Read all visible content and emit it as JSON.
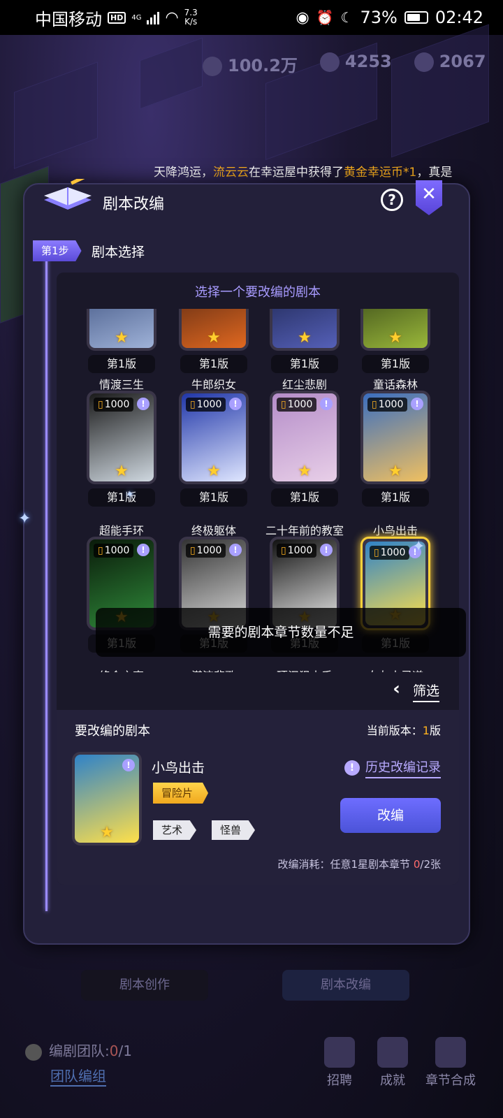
{
  "status_bar": {
    "carrier": "中国移动",
    "hd": "HD",
    "network": "4G",
    "speed_value": "7.3",
    "speed_unit": "K/s",
    "battery": "73%",
    "time": "02:42"
  },
  "currencies": [
    {
      "icon": "coin-icon",
      "value": "100.2万"
    },
    {
      "icon": "trophy-icon",
      "value": "4253"
    },
    {
      "icon": "energy-icon",
      "value": "2067"
    }
  ],
  "marquee": {
    "prefix": "天降鸿运，",
    "user": "流云云",
    "middle": "在幸运屋中获得了",
    "item": "黄金幸运币*1",
    "suffix": "，真是"
  },
  "modal": {
    "title": "剧本改编",
    "help_icon": "?",
    "close_icon": "✕",
    "step_tag": "第1步",
    "step_title": "剧本选择",
    "subtitle": "选择一个要改编的剧本",
    "version_label": "第1版",
    "cost_value": "1000",
    "toast": "需要的剧本章节数量不足",
    "filter_label": "筛选"
  },
  "scripts": [
    {
      "name": "",
      "colors": [
        "#2a3e6e",
        "#9fb2d8"
      ]
    },
    {
      "name": "",
      "colors": [
        "#3a1a10",
        "#e06820"
      ]
    },
    {
      "name": "",
      "colors": [
        "#101838",
        "#5560b8"
      ]
    },
    {
      "name": "",
      "colors": [
        "#1e2a10",
        "#9ab83a"
      ]
    },
    {
      "name": "情渡三生",
      "colors": [
        "#1a1a1a",
        "#cfd8e0"
      ]
    },
    {
      "name": "牛郎织女",
      "colors": [
        "#2036a8",
        "#dfe6ff"
      ]
    },
    {
      "name": "红尘悲剧",
      "colors": [
        "#b48cc8",
        "#e8cfe8"
      ]
    },
    {
      "name": "童话森林",
      "colors": [
        "#3a6ec0",
        "#f0c060"
      ]
    },
    {
      "name": "超能手环",
      "colors": [
        "#0a1a0a",
        "#2f8a3a"
      ]
    },
    {
      "name": "终极躯体",
      "colors": [
        "#333",
        "#d8d8d8"
      ]
    },
    {
      "name": "二十年前的教室",
      "colors": [
        "#111",
        "#e8e8e8"
      ]
    },
    {
      "name": "小鸟出击",
      "colors": [
        "#2f82c8",
        "#ffe04a"
      ]
    },
    {
      "name": "终会之声",
      "colors": [
        "#333",
        "#555"
      ]
    },
    {
      "name": "潜流悲歌",
      "colors": [
        "#333",
        "#555"
      ]
    },
    {
      "name": "硬汉狙击手",
      "colors": [
        "#333",
        "#555"
      ]
    },
    {
      "name": "女友大灵道",
      "colors": [
        "#333",
        "#555"
      ]
    }
  ],
  "selected": {
    "section_title": "要改编的剧本",
    "current_version_label": "当前版本：",
    "current_version_num": "1",
    "current_version_unit": "版",
    "name": "小鸟出击",
    "genre": "冒险片",
    "tags": [
      "艺术",
      "怪兽"
    ],
    "history_label": "历史改编记录",
    "adapt_button": "改编",
    "cost_prefix": "改编消耗：任意1星剧本章节 ",
    "cost_have": "0",
    "cost_need": "/2张"
  },
  "background_tabs": {
    "create": "剧本创作",
    "adapt": "剧本改编"
  },
  "footer": {
    "team_label": "编剧团队:",
    "team_count": "0",
    "team_total": "/1",
    "team_link": "团队编组",
    "buttons": [
      "招聘",
      "成就",
      "章节合成"
    ]
  }
}
